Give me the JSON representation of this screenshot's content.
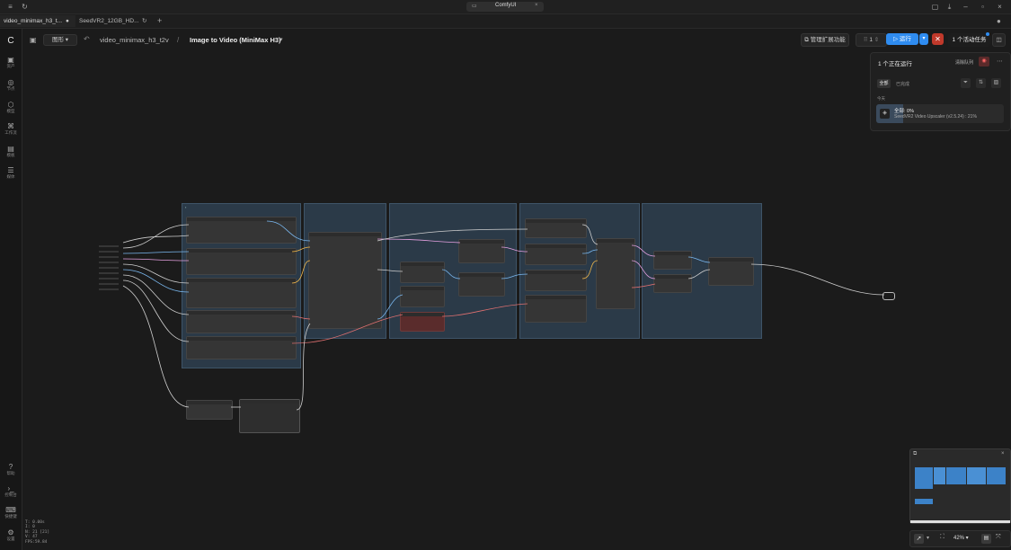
{
  "os": {
    "app_title": "ComfyUI",
    "close_glyph": "×"
  },
  "tabs": [
    {
      "label": "video_minimax_h3_t...",
      "status": "●"
    },
    {
      "label": "SeedVR2_12GB_HD...",
      "status": "↻"
    }
  ],
  "tab_add": "+",
  "sidebar": {
    "top": [
      {
        "icon": "assets-icon",
        "label": "资产"
      },
      {
        "icon": "nodes-icon",
        "label": "节点"
      },
      {
        "icon": "models-icon",
        "label": "模型"
      },
      {
        "icon": "workflow-icon",
        "label": "工作流"
      },
      {
        "icon": "template-icon",
        "label": "模板"
      },
      {
        "icon": "cards-icon",
        "label": "媒体"
      }
    ],
    "bottom": [
      {
        "icon": "help-icon",
        "label": "帮助"
      },
      {
        "icon": "console-icon",
        "label": "控制台"
      },
      {
        "icon": "shortcuts-icon",
        "label": "快捷键"
      },
      {
        "icon": "settings-icon",
        "label": "设置"
      }
    ]
  },
  "header": {
    "view_mode": "图形",
    "breadcrumb_workflow": "video_minimax_h3_t2v",
    "breadcrumb_sep": "/",
    "breadcrumb_title": "Image to Video (MiniMax H3)",
    "manage_extensions": "管理扩展功能",
    "batch_count": "1",
    "run_label": "运行",
    "active_tasks": "1 个活动任务"
  },
  "queue": {
    "running_title": "1 个正在运行",
    "clear_queue": "清除队列",
    "filter_all": "全部",
    "filter_done": "已完成",
    "section_today": "今天",
    "job_title": "全部: 0%",
    "job_subtitle": "SeedVR2 Video Upscaler (v2.5.24) : 21%",
    "job_progress": 0.21
  },
  "stats": [
    "T: 0.00s",
    "I: 0",
    "N: 21 [21]",
    "V: 47",
    "FPS:59.84"
  ],
  "zoom": {
    "level": "42%"
  },
  "colors": {
    "accent": "#2f8cf0",
    "stop": "#c0392b",
    "group": "#2b3a48"
  }
}
